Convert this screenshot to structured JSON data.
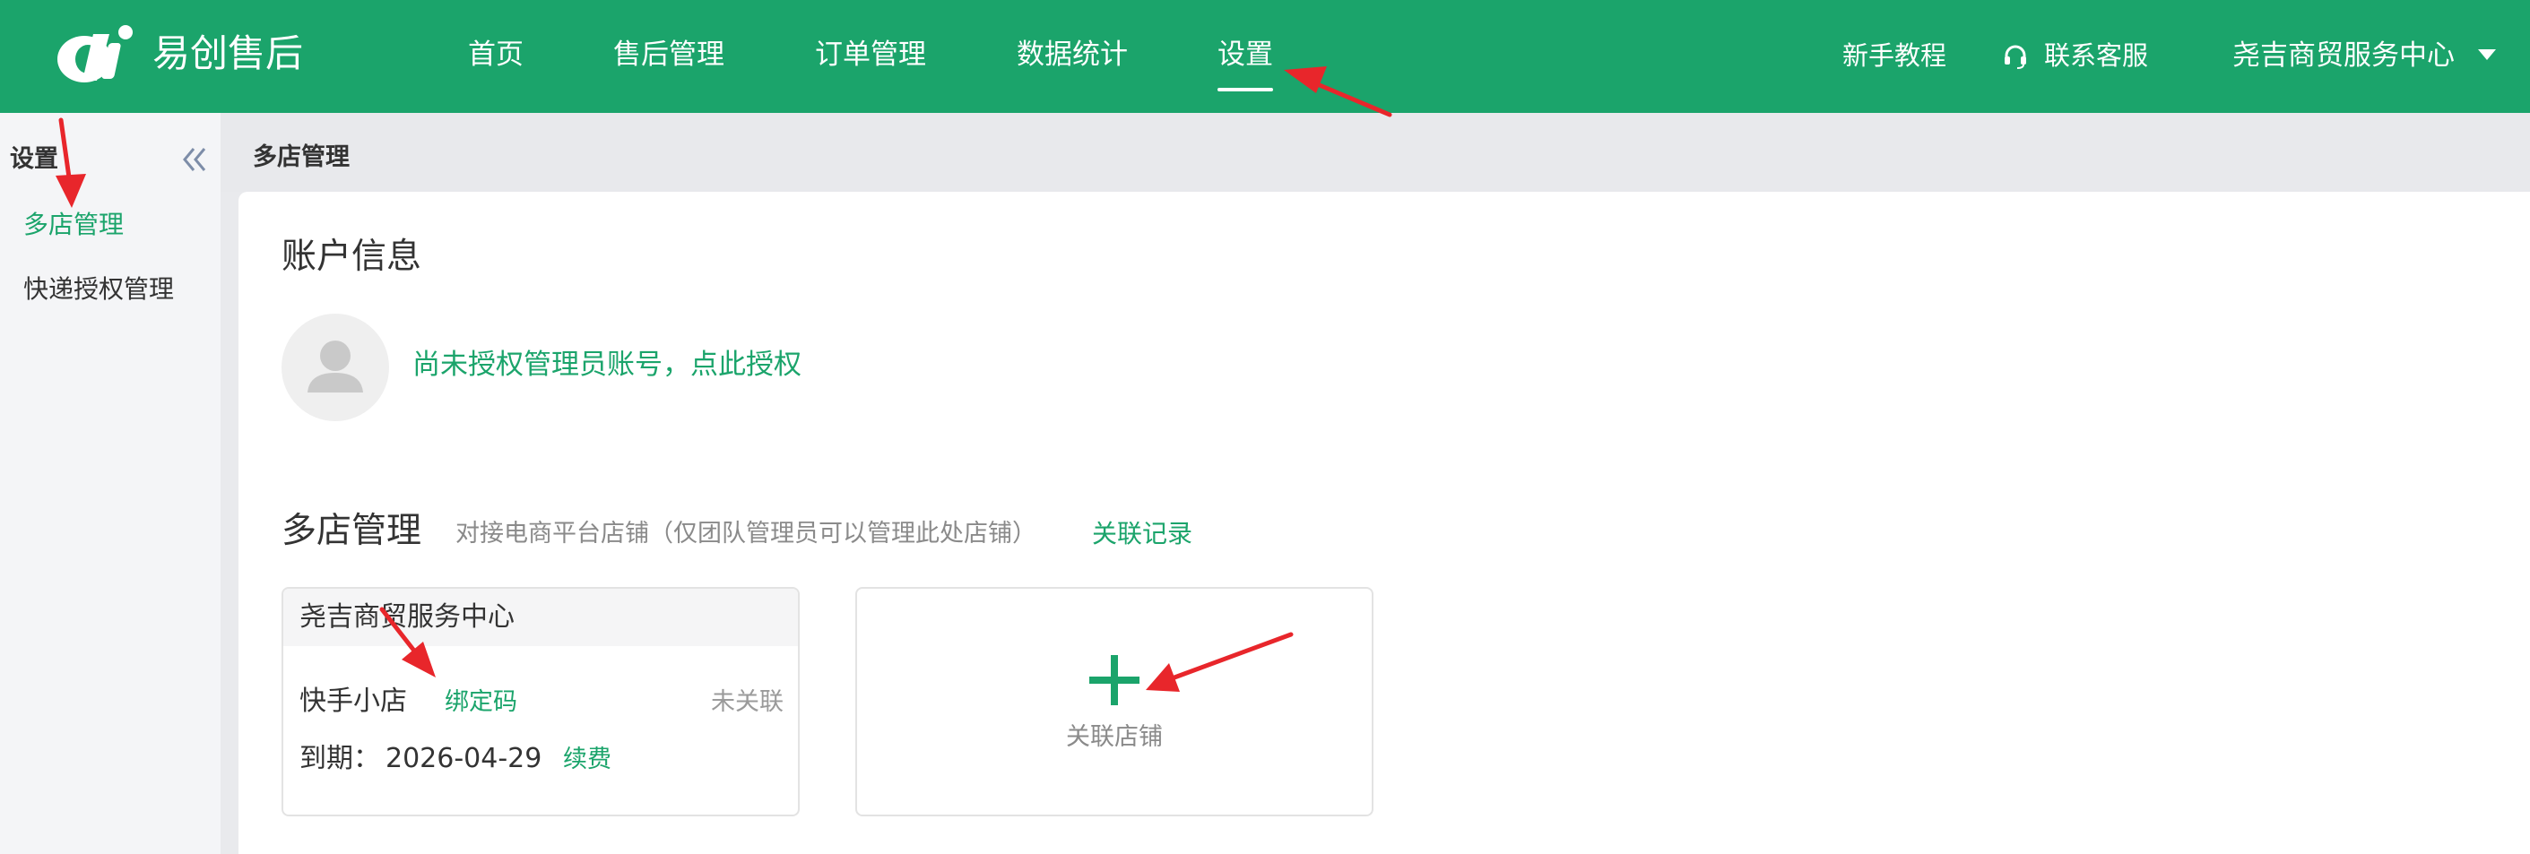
{
  "header": {
    "brand": "易创售后",
    "nav": [
      {
        "label": "首页"
      },
      {
        "label": "售后管理"
      },
      {
        "label": "订单管理"
      },
      {
        "label": "数据统计"
      },
      {
        "label": "设置",
        "active": true
      }
    ],
    "tutorial": "新手教程",
    "support": "联系客服",
    "account": "尧吉商贸服务中心",
    "icons": [
      "logo-icon",
      "headset-icon",
      "caret-down-icon"
    ]
  },
  "sidebar": {
    "title": "设置",
    "items": [
      {
        "label": "多店管理",
        "active": true
      },
      {
        "label": "快递授权管理"
      }
    ]
  },
  "breadcrumb": "多店管理",
  "account_info": {
    "title": "账户信息",
    "auth_link": "尚未授权管理员账号，点此授权"
  },
  "multi_store": {
    "title": "多店管理",
    "description": "对接电商平台店铺（仅团队管理员可以管理此处店铺）",
    "records_link": "关联记录",
    "shop": {
      "name": "尧吉商贸服务中心",
      "platform": "快手小店",
      "bind_code": "绑定码",
      "status": "未关联",
      "expire_label": "到期：",
      "expire_date": "2026-04-29",
      "renew": "续费"
    },
    "add_label": "关联店铺"
  },
  "colors": {
    "brand_green": "#1ba46b",
    "annotation_red": "#e8262b"
  }
}
